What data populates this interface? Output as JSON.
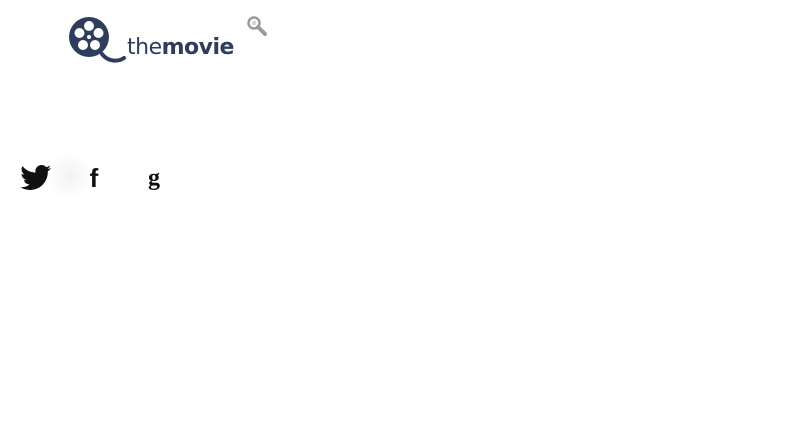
{
  "header": {
    "logo": {
      "text_light": "the",
      "text_bold": "movie",
      "icon": "film-reel-icon",
      "color": "#2e3d5c"
    },
    "search": {
      "icon": "search-icon",
      "color": "#9a9a9a"
    }
  },
  "social": {
    "items": [
      {
        "name": "twitter",
        "icon": "twitter-icon"
      },
      {
        "name": "facebook",
        "icon": "facebook-icon",
        "glyph": "f"
      },
      {
        "name": "google",
        "icon": "google-icon",
        "glyph": "g"
      }
    ]
  }
}
